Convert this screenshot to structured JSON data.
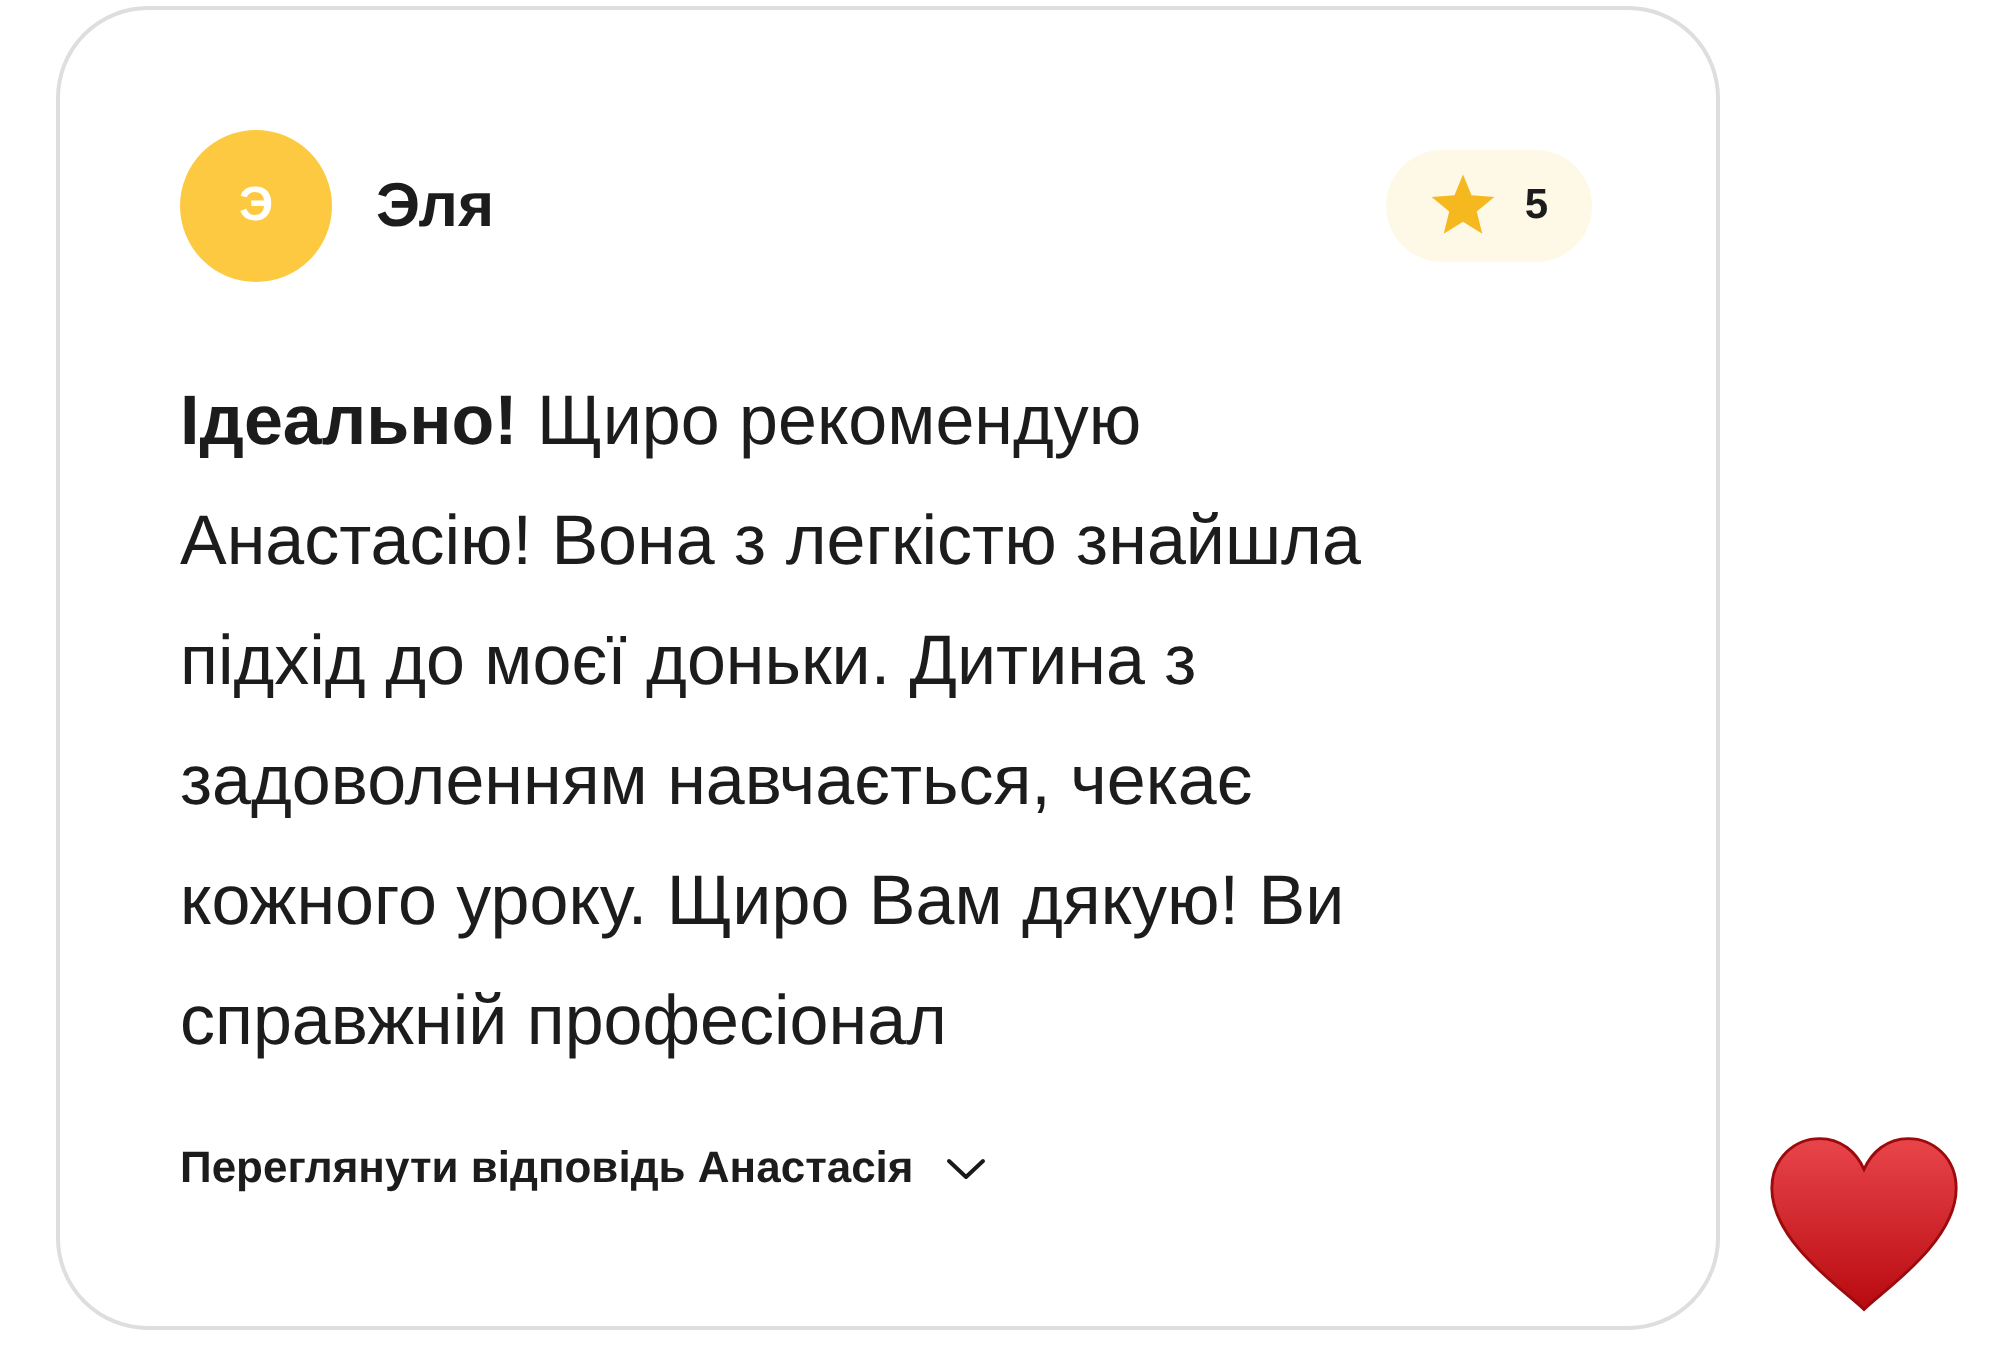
{
  "review": {
    "author": {
      "initial": "Э",
      "name": "Эля"
    },
    "rating": "5",
    "text": "**Ідеально!** Щиро рекомендую\nАнастасію! Вона з легкістю знайшла\nпідхід до моєї доньки. Дитина з\nзадоволенням навчається, чекає\nкожного уроку. Щиро Вам дякую! Ви\nсправжній професіонал",
    "reply_toggle": {
      "label": "Переглянути відповідь Анастасія",
      "expanded": false
    }
  }
}
